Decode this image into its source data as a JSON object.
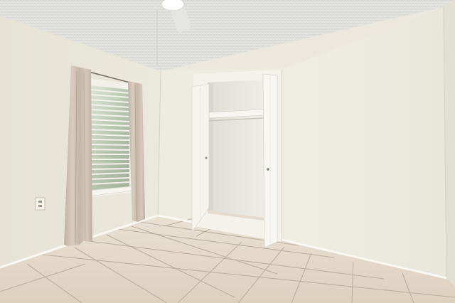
{
  "scene": {
    "kind": "photo",
    "subject": "empty-bedroom",
    "colors": {
      "ceiling": "#e3e3df",
      "left_wall": "#e8e5d9",
      "back_wall": "#eeebe0",
      "right_wall": "#efece2",
      "floor_tile": "#e6dbcd",
      "grout": "#b8ab9b",
      "curtain": "#cdbfb2",
      "closet_door": "#f5f3ee",
      "window_glass": "#c9d3c2"
    },
    "icons": [
      "ceiling-fan-icon",
      "electrical-outlet-icon"
    ]
  }
}
